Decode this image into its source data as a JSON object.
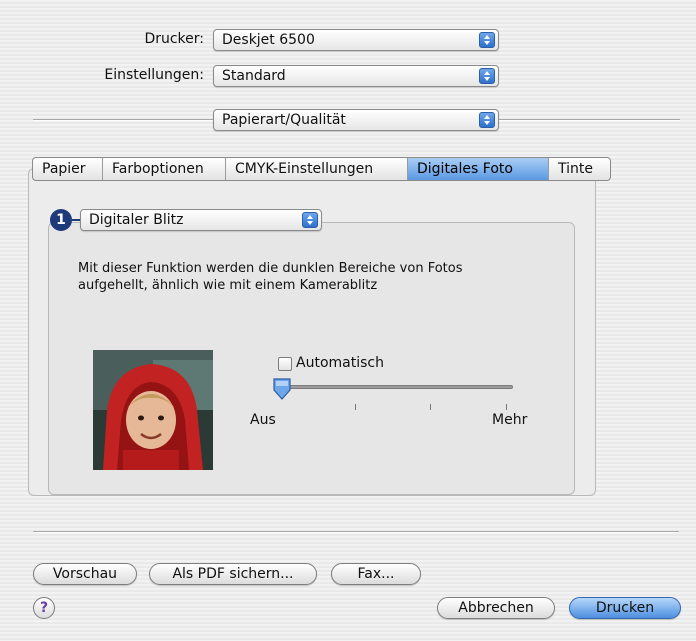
{
  "printer": {
    "label": "Drucker:",
    "value": "Deskjet 6500"
  },
  "settings": {
    "label": "Einstellungen:",
    "value": "Standard"
  },
  "pane_popup": {
    "value": "Papierart/Qualität"
  },
  "tabs": [
    {
      "label": "Papier"
    },
    {
      "label": "Farboptionen"
    },
    {
      "label": "CMYK-Einstellungen"
    },
    {
      "label": "Digitales Foto",
      "active": true
    },
    {
      "label": "Tinte"
    }
  ],
  "callout_number": "1",
  "feature_popup": {
    "value": "Digitaler Blitz"
  },
  "description": "Mit dieser Funktion werden die dunklen Bereiche von Fotos aufgehellt, ähnlich wie mit einem Kamerablitz",
  "automatic": {
    "label": "Automatisch",
    "checked": false
  },
  "slider": {
    "min_label": "Aus",
    "max_label": "Mehr",
    "ticks": 4,
    "position": 0
  },
  "buttons": {
    "preview": "Vorschau",
    "save_pdf": "Als PDF sichern...",
    "fax": "Fax...",
    "cancel": "Abbrechen",
    "print": "Drucken"
  },
  "help_glyph": "?",
  "colors": {
    "accent": "#3a7bd5",
    "callout": "#1d3b7a"
  }
}
